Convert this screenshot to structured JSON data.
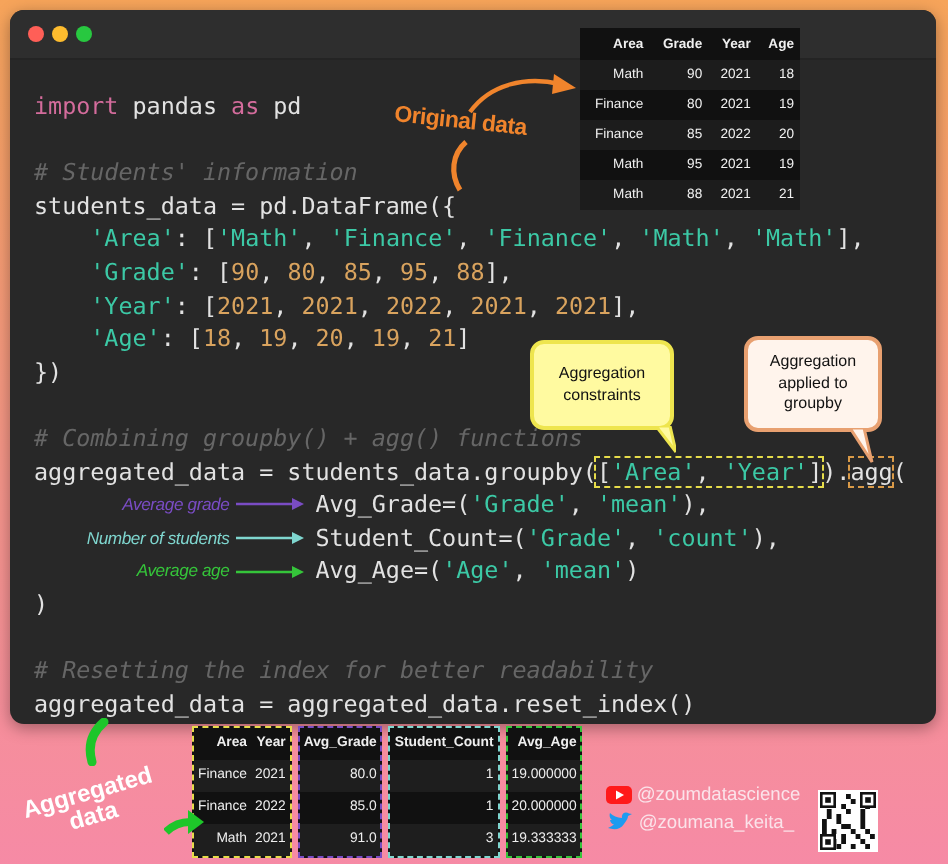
{
  "window": {
    "controls": [
      {
        "color": "#ff5f57"
      },
      {
        "color": "#febc2e"
      },
      {
        "color": "#28c840"
      }
    ]
  },
  "code_lines": [
    {
      "kind": "top",
      "tokens": [
        {
          "kind": "kw",
          "text": "import"
        },
        {
          "kind": "plain",
          "text": " pandas "
        },
        {
          "kind": "kw",
          "text": "as"
        },
        {
          "kind": "plain",
          "text": " pd"
        }
      ]
    },
    {
      "kind": "blank"
    },
    {
      "kind": "top",
      "tokens": [
        {
          "kind": "comment",
          "text": "# Students' information"
        }
      ]
    },
    {
      "kind": "top",
      "tokens": [
        {
          "kind": "plain",
          "text": "students_data = pd.DataFrame({"
        }
      ]
    },
    {
      "kind": "item",
      "tokens": [
        {
          "kind": "str",
          "text": "'Area'"
        },
        {
          "kind": "plain",
          "text": ": ["
        },
        {
          "kind": "str",
          "text": "'Math'"
        },
        {
          "kind": "plain",
          "text": ", "
        },
        {
          "kind": "str",
          "text": "'Finance'"
        },
        {
          "kind": "plain",
          "text": ", "
        },
        {
          "kind": "str",
          "text": "'Finance'"
        },
        {
          "kind": "plain",
          "text": ", "
        },
        {
          "kind": "str",
          "text": "'Math'"
        },
        {
          "kind": "plain",
          "text": ", "
        },
        {
          "kind": "str",
          "text": "'Math'"
        },
        {
          "kind": "plain",
          "text": "],"
        }
      ]
    },
    {
      "kind": "item",
      "tokens": [
        {
          "kind": "str",
          "text": "'Grade'"
        },
        {
          "kind": "plain",
          "text": ": ["
        },
        {
          "kind": "num",
          "text": "90"
        },
        {
          "kind": "plain",
          "text": ", "
        },
        {
          "kind": "num",
          "text": "80"
        },
        {
          "kind": "plain",
          "text": ", "
        },
        {
          "kind": "num",
          "text": "85"
        },
        {
          "kind": "plain",
          "text": ", "
        },
        {
          "kind": "num",
          "text": "95"
        },
        {
          "kind": "plain",
          "text": ", "
        },
        {
          "kind": "num",
          "text": "88"
        },
        {
          "kind": "plain",
          "text": "],"
        }
      ]
    },
    {
      "kind": "item",
      "tokens": [
        {
          "kind": "str",
          "text": "'Year'"
        },
        {
          "kind": "plain",
          "text": ": ["
        },
        {
          "kind": "num",
          "text": "2021"
        },
        {
          "kind": "plain",
          "text": ", "
        },
        {
          "kind": "num",
          "text": "2021"
        },
        {
          "kind": "plain",
          "text": ", "
        },
        {
          "kind": "num",
          "text": "2022"
        },
        {
          "kind": "plain",
          "text": ", "
        },
        {
          "kind": "num",
          "text": "2021"
        },
        {
          "kind": "plain",
          "text": ", "
        },
        {
          "kind": "num",
          "text": "2021"
        },
        {
          "kind": "plain",
          "text": "],"
        }
      ]
    },
    {
      "kind": "item",
      "tokens": [
        {
          "kind": "str",
          "text": "'Age'"
        },
        {
          "kind": "plain",
          "text": ": ["
        },
        {
          "kind": "num",
          "text": "18"
        },
        {
          "kind": "plain",
          "text": ", "
        },
        {
          "kind": "num",
          "text": "19"
        },
        {
          "kind": "plain",
          "text": ", "
        },
        {
          "kind": "num",
          "text": "20"
        },
        {
          "kind": "plain",
          "text": ", "
        },
        {
          "kind": "num",
          "text": "19"
        },
        {
          "kind": "plain",
          "text": ", "
        },
        {
          "kind": "num",
          "text": "21"
        },
        {
          "kind": "plain",
          "text": "]"
        }
      ]
    },
    {
      "kind": "top",
      "tokens": [
        {
          "kind": "plain",
          "text": "})"
        }
      ]
    },
    {
      "kind": "blank"
    },
    {
      "kind": "top",
      "tokens": [
        {
          "kind": "comment",
          "text": "# Combining groupby() + agg() functions"
        }
      ]
    },
    {
      "kind": "top",
      "tokens": [
        {
          "kind": "plain",
          "text": "aggregated_data = students_data.groupby("
        },
        {
          "kind": "box",
          "color": "#e6dc4a",
          "tokens": [
            {
              "kind": "plain",
              "text": "["
            },
            {
              "kind": "str",
              "text": "'Area'"
            },
            {
              "kind": "plain",
              "text": ", "
            },
            {
              "kind": "str",
              "text": "'Year'"
            },
            {
              "kind": "plain",
              "text": "]"
            }
          ]
        },
        {
          "kind": "plain",
          "text": ")."
        },
        {
          "kind": "box",
          "color": "#d99a48",
          "tokens": [
            {
              "kind": "plain",
              "text": "agg"
            }
          ]
        },
        {
          "kind": "plain",
          "text": "("
        }
      ]
    },
    {
      "kind": "arg",
      "annotation": {
        "label": "Average grade",
        "color": "#7a4cc4"
      },
      "tokens": [
        {
          "kind": "plain",
          "text": "Avg_Grade=("
        },
        {
          "kind": "str",
          "text": "'Grade'"
        },
        {
          "kind": "plain",
          "text": ", "
        },
        {
          "kind": "str",
          "text": "'mean'"
        },
        {
          "kind": "plain",
          "text": "),"
        }
      ]
    },
    {
      "kind": "arg",
      "annotation": {
        "label": "Number of students",
        "color": "#7fd6cf"
      },
      "tokens": [
        {
          "kind": "plain",
          "text": "Student_Count=("
        },
        {
          "kind": "str",
          "text": "'Grade'"
        },
        {
          "kind": "plain",
          "text": ", "
        },
        {
          "kind": "str",
          "text": "'count'"
        },
        {
          "kind": "plain",
          "text": "),"
        }
      ]
    },
    {
      "kind": "arg",
      "annotation": {
        "label": "Average age",
        "color": "#35c53a"
      },
      "tokens": [
        {
          "kind": "plain",
          "text": "Avg_Age=("
        },
        {
          "kind": "str",
          "text": "'Age'"
        },
        {
          "kind": "plain",
          "text": ", "
        },
        {
          "kind": "str",
          "text": "'mean'"
        },
        {
          "kind": "plain",
          "text": ")"
        }
      ]
    },
    {
      "kind": "top",
      "tokens": [
        {
          "kind": "plain",
          "text": ")"
        }
      ]
    },
    {
      "kind": "blank"
    },
    {
      "kind": "top",
      "tokens": [
        {
          "kind": "comment",
          "text": "# Resetting the index for better readability"
        }
      ]
    },
    {
      "kind": "top",
      "tokens": [
        {
          "kind": "plain",
          "text": "aggregated_data = aggregated_data.reset_index()"
        }
      ]
    }
  ],
  "original_data": {
    "label": "Original data",
    "columns": [
      "Area",
      "Grade",
      "Year",
      "Age"
    ],
    "rows": [
      [
        "Math",
        "90",
        "2021",
        "18"
      ],
      [
        "Finance",
        "80",
        "2021",
        "19"
      ],
      [
        "Finance",
        "85",
        "2022",
        "20"
      ],
      [
        "Math",
        "95",
        "2021",
        "19"
      ],
      [
        "Math",
        "88",
        "2021",
        "21"
      ]
    ]
  },
  "callouts": [
    {
      "kind": "constraints",
      "text": "Aggregation constraints"
    },
    {
      "kind": "applied",
      "text": "Aggregation applied to groupby"
    }
  ],
  "aggregated_data": {
    "label": "Aggregated data",
    "groups": [
      {
        "color": "#e6dc4a",
        "columns": [
          {
            "header": "Area",
            "cells": [
              "Finance",
              "Finance",
              "Math"
            ]
          },
          {
            "header": "Year",
            "cells": [
              "2021",
              "2022",
              "2021"
            ]
          }
        ]
      },
      {
        "color": "#7a4cc4",
        "columns": [
          {
            "header": "Avg_Grade",
            "cells": [
              "80.0",
              "85.0",
              "91.0"
            ]
          }
        ]
      },
      {
        "color": "#7fd6cf",
        "columns": [
          {
            "header": "Student_Count",
            "cells": [
              "1",
              "1",
              "3"
            ]
          }
        ]
      },
      {
        "color": "#35c53a",
        "columns": [
          {
            "header": "Avg_Age",
            "cells": [
              "19.000000",
              "20.000000",
              "19.333333"
            ]
          }
        ]
      }
    ]
  },
  "social": [
    {
      "kind": "video",
      "handle": "@zoumdatascience"
    },
    {
      "kind": "bird",
      "handle": "@zoumana_keita_"
    }
  ]
}
